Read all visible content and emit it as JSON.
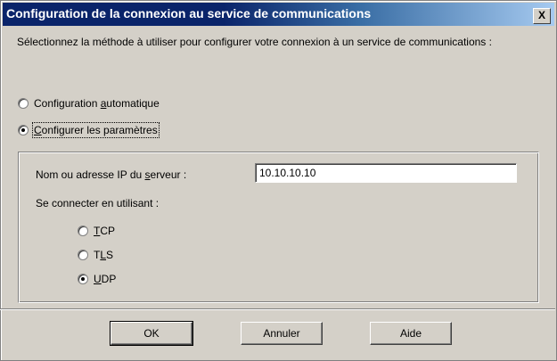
{
  "window": {
    "title": "Configuration de la connexion au service de communications",
    "close_label": "X"
  },
  "instructions": "Sélectionnez la méthode à utiliser pour configurer votre connexion à un service de communications :",
  "mode_options": [
    {
      "pre": "Configuration ",
      "key": "a",
      "post": "utomatique",
      "checked": false
    },
    {
      "pre": "",
      "key": "C",
      "post": "onfigurer les paramètres",
      "checked": true
    }
  ],
  "server": {
    "label_pre": "Nom ou adresse IP du ",
    "label_key": "s",
    "label_post": "erveur :",
    "value": "10.10.10.10"
  },
  "connect_label": "Se connecter en utilisant :",
  "protocols": [
    {
      "pre": "",
      "key": "T",
      "post": "CP",
      "checked": false
    },
    {
      "pre": "T",
      "key": "L",
      "post": "S",
      "checked": false
    },
    {
      "pre": "",
      "key": "U",
      "post": "DP",
      "checked": true
    }
  ],
  "buttons": {
    "ok": "OK",
    "cancel": "Annuler",
    "help": "Aide"
  }
}
